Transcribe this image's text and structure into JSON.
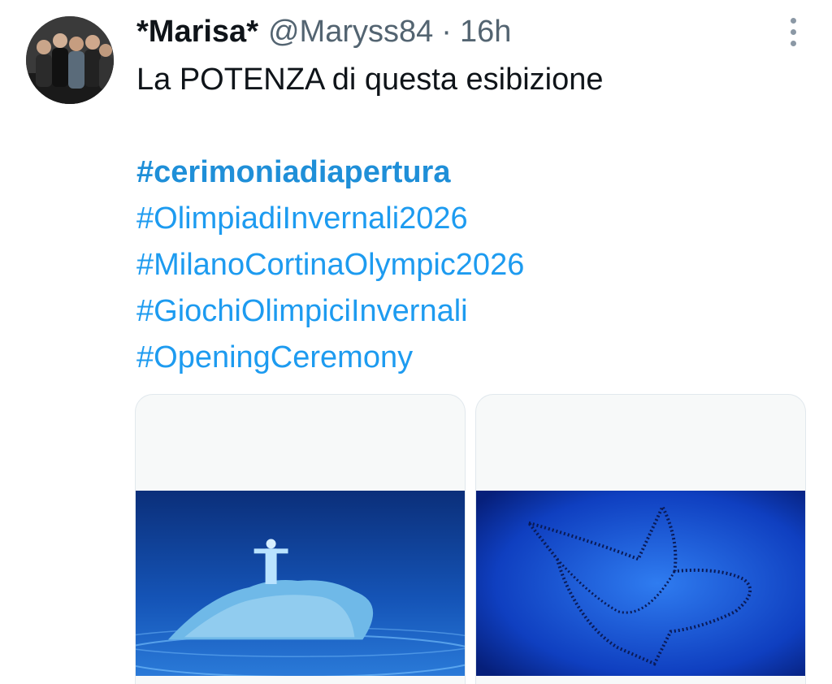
{
  "tweet": {
    "author_name": "*Marisa*",
    "handle": "@Maryss84",
    "separator": "·",
    "time": "16h",
    "text_line": "La POTENZA di questa esibizione",
    "hashtags": [
      "#cerimoniadiapertura",
      "#OlimpiadiInvernali2026",
      "#MilanoCortinaOlympic2026",
      "#GiochiOlimpiciInvernali",
      "#OpeningCeremony"
    ],
    "icons": {
      "more": "more-vertical-icon"
    },
    "colors": {
      "hashtag": "#1d9bf0",
      "secondary_text": "#536471",
      "primary_text": "#0f1419"
    }
  }
}
